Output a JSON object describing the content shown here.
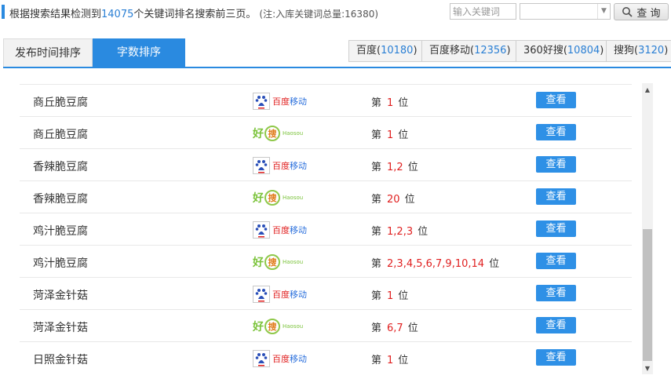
{
  "summary": {
    "prefix": "根据搜索结果检测到",
    "count": "14075",
    "suffix": "个关键词排名搜索前三页。",
    "note": "(注:入库关键词总量:16380)"
  },
  "search": {
    "placeholder": "输入关键词",
    "select_value": "",
    "query_label": "查 询"
  },
  "tabs": [
    {
      "label": "发布时间排序",
      "active": false
    },
    {
      "label": "字数排序",
      "active": true
    }
  ],
  "engines": [
    {
      "name": "百度",
      "count": "10180"
    },
    {
      "name": "百度移动",
      "count": "12356"
    },
    {
      "name": "360好搜",
      "count": "10804"
    },
    {
      "name": "搜狗",
      "count": "3120"
    }
  ],
  "rank_prefix": "第",
  "rank_suffix": "位",
  "view_label": "查看",
  "logos": {
    "baidu": {
      "icon": "baidu-paw-icon",
      "text_a": "百度",
      "text_b": "移动"
    },
    "haosou": {
      "icon": "haosou-icon",
      "hao": "好",
      "sou": "搜",
      "en": "Haosou"
    }
  },
  "rows": [
    {
      "keyword": "商丘脆豆腐",
      "engine": "baidu",
      "position": "1"
    },
    {
      "keyword": "商丘脆豆腐",
      "engine": "haosou",
      "position": "1"
    },
    {
      "keyword": "香辣脆豆腐",
      "engine": "baidu",
      "position": "1,2"
    },
    {
      "keyword": "香辣脆豆腐",
      "engine": "haosou",
      "position": "20"
    },
    {
      "keyword": "鸡汁脆豆腐",
      "engine": "baidu",
      "position": "1,2,3"
    },
    {
      "keyword": "鸡汁脆豆腐",
      "engine": "haosou",
      "position": "2,3,4,5,6,7,9,10,14"
    },
    {
      "keyword": "菏泽金针菇",
      "engine": "baidu",
      "position": "1"
    },
    {
      "keyword": "菏泽金针菇",
      "engine": "haosou",
      "position": "6,7"
    },
    {
      "keyword": "日照金针菇",
      "engine": "baidu",
      "position": "1"
    }
  ]
}
